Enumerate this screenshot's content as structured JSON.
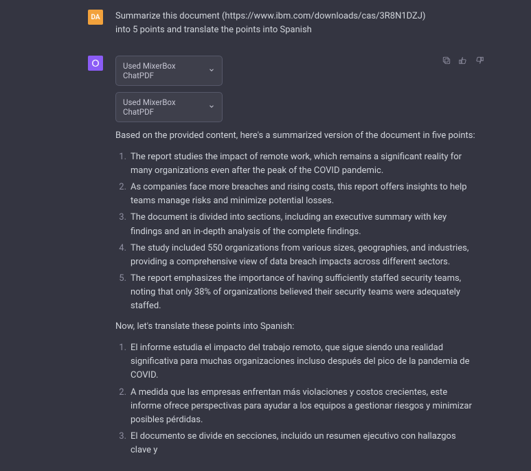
{
  "user": {
    "avatar_initials": "DA",
    "prompt": "Summarize this document (https://www.ibm.com/downloads/cas/3R8N1DZJ) into 5 points and translate the points into Spanish"
  },
  "assistant": {
    "chips": [
      {
        "label": "Used MixerBox ChatPDF"
      },
      {
        "label": "Used MixerBox ChatPDF"
      }
    ],
    "intro": "Based on the provided content, here's a summarized version of the document in five points:",
    "points_en": [
      "The report studies the impact of remote work, which remains a significant reality for many organizations even after the peak of the COVID pandemic.",
      "As companies face more breaches and rising costs, this report offers insights to help teams manage risks and minimize potential losses.",
      "The document is divided into sections, including an executive summary with key findings and an in-depth analysis of the complete findings.",
      "The study included 550 organizations from various sizes, geographies, and industries, providing a comprehensive view of data breach impacts across different sectors.",
      "The report emphasizes the importance of having sufficiently staffed security teams, noting that only 38% of organizations believed their security teams were adequately staffed."
    ],
    "bridge": "Now, let's translate these points into Spanish:",
    "points_es": [
      "El informe estudia el impacto del trabajo remoto, que sigue siendo una realidad significativa para muchas organizaciones incluso después del pico de la pandemia de COVID.",
      "A medida que las empresas enfrentan más violaciones y costos crecientes, este informe ofrece perspectivas para ayudar a los equipos a gestionar riesgos y minimizar posibles pérdidas.",
      "El documento se divide en secciones, incluido un resumen ejecutivo con hallazgos clave y"
    ]
  },
  "numbers": {
    "1": "1.",
    "2": "2.",
    "3": "3.",
    "4": "4.",
    "5": "5."
  }
}
